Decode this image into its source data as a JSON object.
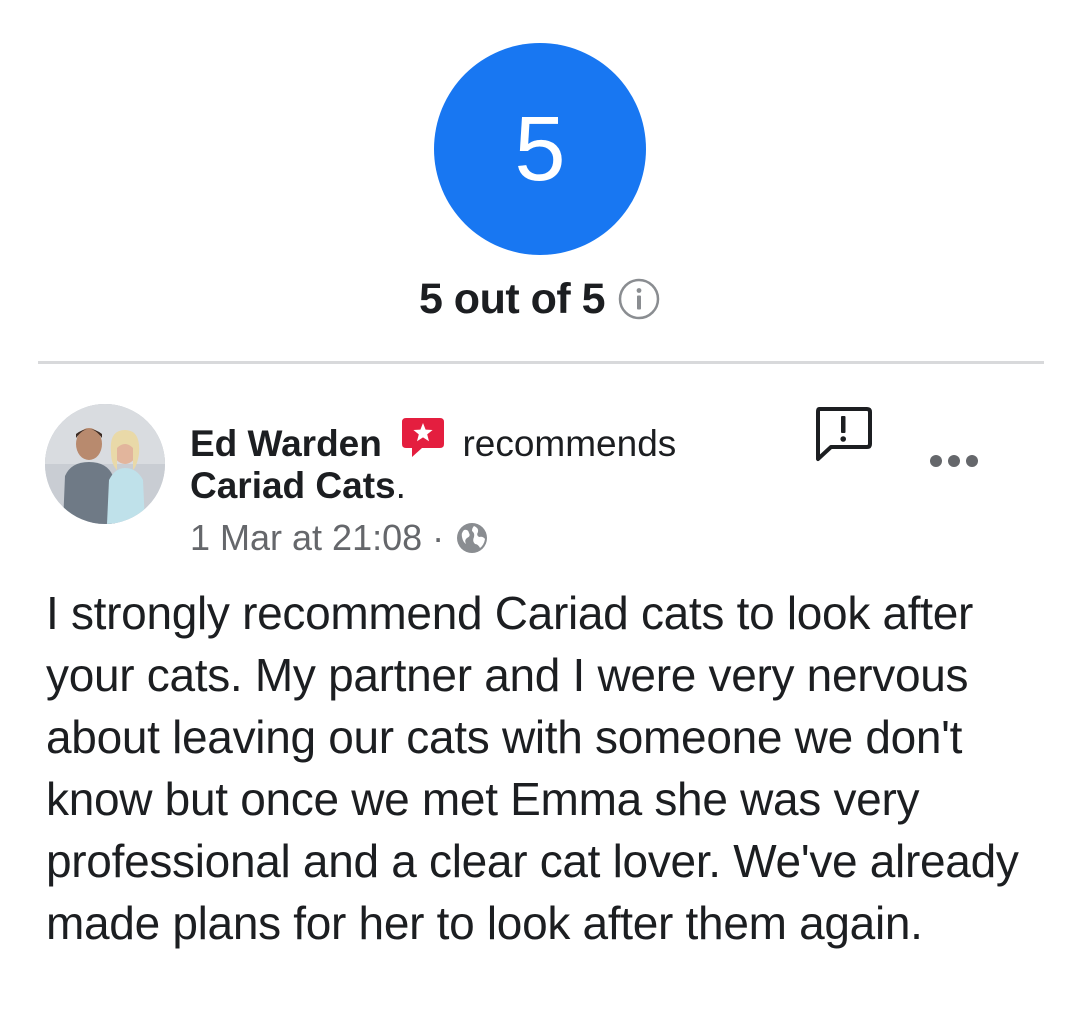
{
  "rating": {
    "score": "5",
    "summary": "5 out of 5",
    "info_icon": "info-circle-icon",
    "accent_color": "#1877f2"
  },
  "review": {
    "author": "Ed Warden",
    "badge_icon": "recommendation-star-icon",
    "badge_color": "#e41e3f",
    "verb": "recommends",
    "page": "Cariad Cats",
    "page_suffix": ".",
    "timestamp": "1 Mar at 21:08",
    "separator": "·",
    "audience_icon": "globe-icon",
    "report_icon": "report-exclamation-icon",
    "more_icon": "more-dots-icon",
    "text": "I strongly recommend Cariad cats to look after your cats. My partner and I were very nervous about leaving our cats with someone we don't know but once we met Emma she was very professional and a clear cat lover. We've already made plans for her to look after them again."
  }
}
